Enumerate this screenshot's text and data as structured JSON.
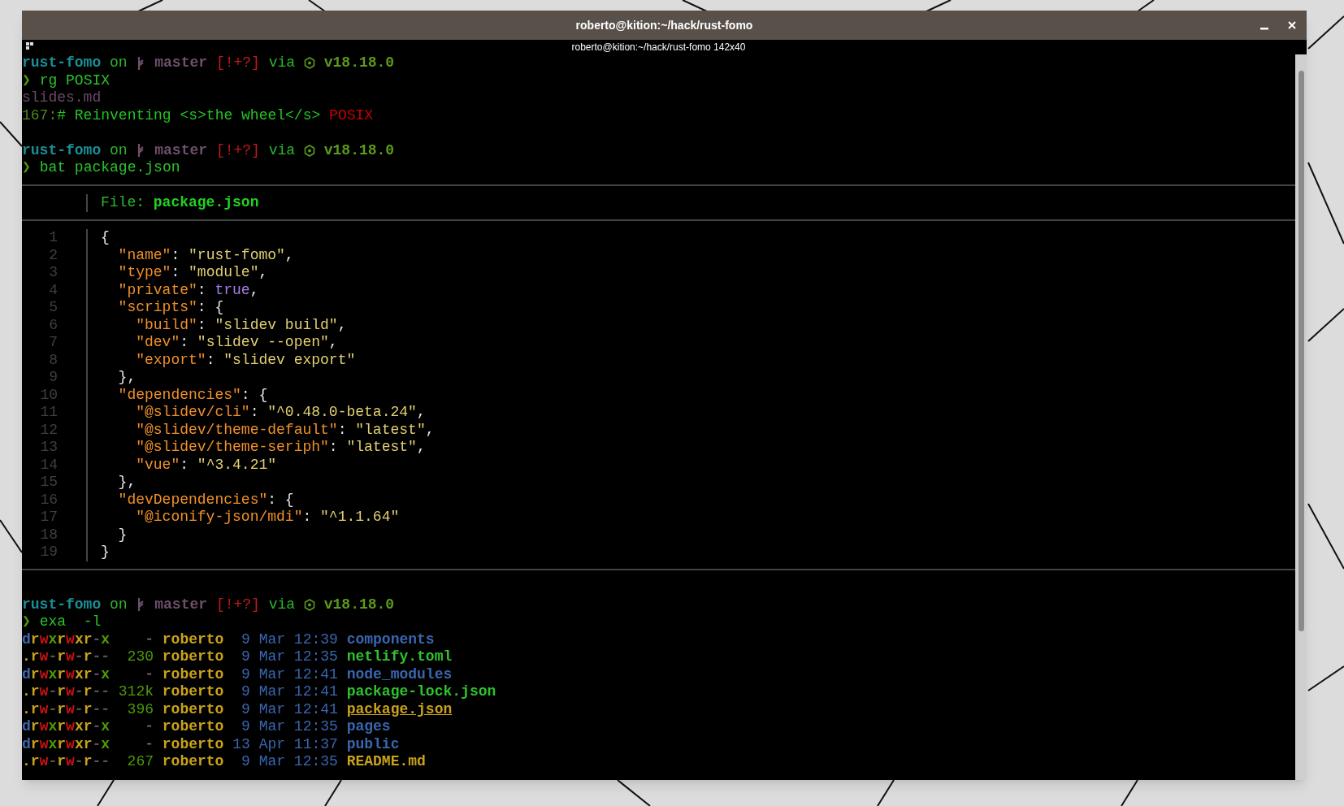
{
  "window": {
    "title": "roberto@kition:~/hack/rust-fomo",
    "subtitle": "roberto@kition:~/hack/rust-fomo 142x40"
  },
  "terminal": {
    "blocks": [
      {
        "kind": "prompt",
        "dir": "rust-fomo",
        "on": "on",
        "branch": "master",
        "status": "[!+?]",
        "via": "via",
        "version": "v18.18.0",
        "symbol": "❯",
        "command": "rg POSIX"
      },
      {
        "kind": "line",
        "segments": [
          {
            "text": "slides.md",
            "color": "#6a4a68"
          }
        ]
      },
      {
        "kind": "line",
        "segments": [
          {
            "text": "167:",
            "color": "#4f8a10"
          },
          {
            "text": "# Reinventing <s>the wheel</s> ",
            "color": "#22c422"
          },
          {
            "text": "POSIX",
            "color": "#c80000"
          }
        ]
      },
      {
        "kind": "blank"
      },
      {
        "kind": "prompt",
        "dir": "rust-fomo",
        "on": "on",
        "branch": "master",
        "status": "[!+?]",
        "via": "via",
        "version": "v18.18.0",
        "symbol": "❯",
        "command": "bat package.json"
      },
      {
        "kind": "bat",
        "label": "File: ",
        "file": "package.json",
        "lines": [
          {
            "number": "1",
            "segments": [
              {
                "text": "{",
                "color": "#e6e6e6"
              }
            ]
          },
          {
            "number": "2",
            "segments": [
              {
                "text": "  \"name\"",
                "color": "#f0902a"
              },
              {
                "text": ": ",
                "color": "#e6e6e6"
              },
              {
                "text": "\"rust-fomo\"",
                "color": "#e2cf72"
              },
              {
                "text": ",",
                "color": "#e6e6e6"
              }
            ]
          },
          {
            "number": "3",
            "segments": [
              {
                "text": "  \"type\"",
                "color": "#f0902a"
              },
              {
                "text": ": ",
                "color": "#e6e6e6"
              },
              {
                "text": "\"module\"",
                "color": "#e2cf72"
              },
              {
                "text": ",",
                "color": "#e6e6e6"
              }
            ]
          },
          {
            "number": "4",
            "segments": [
              {
                "text": "  \"private\"",
                "color": "#f0902a"
              },
              {
                "text": ": ",
                "color": "#e6e6e6"
              },
              {
                "text": "true",
                "color": "#a77ce8"
              },
              {
                "text": ",",
                "color": "#e6e6e6"
              }
            ]
          },
          {
            "number": "5",
            "segments": [
              {
                "text": "  \"scripts\"",
                "color": "#f0902a"
              },
              {
                "text": ": {",
                "color": "#e6e6e6"
              }
            ]
          },
          {
            "number": "6",
            "segments": [
              {
                "text": "    \"build\"",
                "color": "#f0902a"
              },
              {
                "text": ": ",
                "color": "#e6e6e6"
              },
              {
                "text": "\"slidev build\"",
                "color": "#e2cf72"
              },
              {
                "text": ",",
                "color": "#e6e6e6"
              }
            ]
          },
          {
            "number": "7",
            "segments": [
              {
                "text": "    \"dev\"",
                "color": "#f0902a"
              },
              {
                "text": ": ",
                "color": "#e6e6e6"
              },
              {
                "text": "\"slidev --open\"",
                "color": "#e2cf72"
              },
              {
                "text": ",",
                "color": "#e6e6e6"
              }
            ]
          },
          {
            "number": "8",
            "segments": [
              {
                "text": "    \"export\"",
                "color": "#f0902a"
              },
              {
                "text": ": ",
                "color": "#e6e6e6"
              },
              {
                "text": "\"slidev export\"",
                "color": "#e2cf72"
              }
            ]
          },
          {
            "number": "9",
            "segments": [
              {
                "text": "  },",
                "color": "#e6e6e6"
              }
            ]
          },
          {
            "number": "10",
            "segments": [
              {
                "text": "  \"dependencies\"",
                "color": "#f0902a"
              },
              {
                "text": ": {",
                "color": "#e6e6e6"
              }
            ]
          },
          {
            "number": "11",
            "segments": [
              {
                "text": "    \"@slidev/cli\"",
                "color": "#f0902a"
              },
              {
                "text": ": ",
                "color": "#e6e6e6"
              },
              {
                "text": "\"^0.48.0-beta.24\"",
                "color": "#e2cf72"
              },
              {
                "text": ",",
                "color": "#e6e6e6"
              }
            ]
          },
          {
            "number": "12",
            "segments": [
              {
                "text": "    \"@slidev/theme-default\"",
                "color": "#f0902a"
              },
              {
                "text": ": ",
                "color": "#e6e6e6"
              },
              {
                "text": "\"latest\"",
                "color": "#e2cf72"
              },
              {
                "text": ",",
                "color": "#e6e6e6"
              }
            ]
          },
          {
            "number": "13",
            "segments": [
              {
                "text": "    \"@slidev/theme-seriph\"",
                "color": "#f0902a"
              },
              {
                "text": ": ",
                "color": "#e6e6e6"
              },
              {
                "text": "\"latest\"",
                "color": "#e2cf72"
              },
              {
                "text": ",",
                "color": "#e6e6e6"
              }
            ]
          },
          {
            "number": "14",
            "segments": [
              {
                "text": "    \"vue\"",
                "color": "#f0902a"
              },
              {
                "text": ": ",
                "color": "#e6e6e6"
              },
              {
                "text": "\"^3.4.21\"",
                "color": "#e2cf72"
              }
            ]
          },
          {
            "number": "15",
            "segments": [
              {
                "text": "  },",
                "color": "#e6e6e6"
              }
            ]
          },
          {
            "number": "16",
            "segments": [
              {
                "text": "  \"devDependencies\"",
                "color": "#f0902a"
              },
              {
                "text": ": {",
                "color": "#e6e6e6"
              }
            ]
          },
          {
            "number": "17",
            "segments": [
              {
                "text": "    \"@iconify-json/mdi\"",
                "color": "#f0902a"
              },
              {
                "text": ": ",
                "color": "#e6e6e6"
              },
              {
                "text": "\"^1.1.64\"",
                "color": "#e2cf72"
              }
            ]
          },
          {
            "number": "18",
            "segments": [
              {
                "text": "  }",
                "color": "#e6e6e6"
              }
            ]
          },
          {
            "number": "19",
            "segments": [
              {
                "text": "}",
                "color": "#e6e6e6"
              }
            ]
          }
        ]
      },
      {
        "kind": "blank"
      },
      {
        "kind": "prompt",
        "dir": "rust-fomo",
        "on": "on",
        "branch": "master",
        "status": "[!+?]",
        "via": "via",
        "version": "v18.18.0",
        "symbol": "❯",
        "command": "exa  -l"
      },
      {
        "kind": "listing",
        "rows": [
          {
            "permissions": [
              {
                "text": "d",
                "color": "#3a66b0"
              },
              {
                "text": "r",
                "color": "#c9a21a"
              },
              {
                "text": "w",
                "color": "#cc1111"
              },
              {
                "text": "x",
                "color": "#4e9a06"
              },
              {
                "text": "r",
                "color": "#c9a21a"
              },
              {
                "text": "w",
                "color": "#cc1111"
              },
              {
                "text": "x",
                "color": "#c9a21a"
              },
              {
                "text": "r",
                "color": "#c9a21a"
              },
              {
                "text": "-",
                "color": "#555555"
              },
              {
                "text": "x",
                "color": "#4e9a06"
              }
            ],
            "size": {
              "text": "-",
              "color": "#888888"
            },
            "user": "roberto",
            "date": "9 Mar 12:39",
            "name": {
              "text": "components",
              "color": "#3a66b0",
              "underline": false
            }
          },
          {
            "permissions": [
              {
                "text": ".r",
                "color": "#c9a21a"
              },
              {
                "text": "w",
                "color": "#cc1111"
              },
              {
                "text": "-",
                "color": "#555555"
              },
              {
                "text": "r",
                "color": "#c9a21a"
              },
              {
                "text": "w",
                "color": "#cc1111"
              },
              {
                "text": "-",
                "color": "#555555"
              },
              {
                "text": "r",
                "color": "#c9a21a"
              },
              {
                "text": "--",
                "color": "#555555"
              }
            ],
            "size": {
              "text": "230",
              "color": "#4e9a06"
            },
            "user": "roberto",
            "date": "9 Mar 12:35",
            "name": {
              "text": "netlify.toml",
              "color": "#2ec22e",
              "underline": false
            }
          },
          {
            "permissions": [
              {
                "text": "d",
                "color": "#3a66b0"
              },
              {
                "text": "r",
                "color": "#c9a21a"
              },
              {
                "text": "w",
                "color": "#cc1111"
              },
              {
                "text": "x",
                "color": "#4e9a06"
              },
              {
                "text": "r",
                "color": "#c9a21a"
              },
              {
                "text": "w",
                "color": "#cc1111"
              },
              {
                "text": "x",
                "color": "#c9a21a"
              },
              {
                "text": "r",
                "color": "#c9a21a"
              },
              {
                "text": "-",
                "color": "#555555"
              },
              {
                "text": "x",
                "color": "#4e9a06"
              }
            ],
            "size": {
              "text": "-",
              "color": "#888888"
            },
            "user": "roberto",
            "date": "9 Mar 12:41",
            "name": {
              "text": "node_modules",
              "color": "#3a66b0",
              "underline": false
            }
          },
          {
            "permissions": [
              {
                "text": ".r",
                "color": "#c9a21a"
              },
              {
                "text": "w",
                "color": "#cc1111"
              },
              {
                "text": "-",
                "color": "#555555"
              },
              {
                "text": "r",
                "color": "#c9a21a"
              },
              {
                "text": "w",
                "color": "#cc1111"
              },
              {
                "text": "-",
                "color": "#555555"
              },
              {
                "text": "r",
                "color": "#c9a21a"
              },
              {
                "text": "--",
                "color": "#555555"
              }
            ],
            "size": {
              "text": "312k",
              "color": "#4e9a06"
            },
            "user": "roberto",
            "date": "9 Mar 12:41",
            "name": {
              "text": "package-lock.json",
              "color": "#2ec22e",
              "underline": false
            }
          },
          {
            "permissions": [
              {
                "text": ".r",
                "color": "#c9a21a"
              },
              {
                "text": "w",
                "color": "#cc1111"
              },
              {
                "text": "-",
                "color": "#555555"
              },
              {
                "text": "r",
                "color": "#c9a21a"
              },
              {
                "text": "w",
                "color": "#cc1111"
              },
              {
                "text": "-",
                "color": "#555555"
              },
              {
                "text": "r",
                "color": "#c9a21a"
              },
              {
                "text": "--",
                "color": "#555555"
              }
            ],
            "size": {
              "text": "396",
              "color": "#4e9a06"
            },
            "user": "roberto",
            "date": "9 Mar 12:41",
            "name": {
              "text": "package.json",
              "color": "#c9a21a",
              "underline": true
            }
          },
          {
            "permissions": [
              {
                "text": "d",
                "color": "#3a66b0"
              },
              {
                "text": "r",
                "color": "#c9a21a"
              },
              {
                "text": "w",
                "color": "#cc1111"
              },
              {
                "text": "x",
                "color": "#4e9a06"
              },
              {
                "text": "r",
                "color": "#c9a21a"
              },
              {
                "text": "w",
                "color": "#cc1111"
              },
              {
                "text": "x",
                "color": "#c9a21a"
              },
              {
                "text": "r",
                "color": "#c9a21a"
              },
              {
                "text": "-",
                "color": "#555555"
              },
              {
                "text": "x",
                "color": "#4e9a06"
              }
            ],
            "size": {
              "text": "-",
              "color": "#888888"
            },
            "user": "roberto",
            "date": "9 Mar 12:35",
            "name": {
              "text": "pages",
              "color": "#3a66b0",
              "underline": false
            }
          },
          {
            "permissions": [
              {
                "text": "d",
                "color": "#3a66b0"
              },
              {
                "text": "r",
                "color": "#c9a21a"
              },
              {
                "text": "w",
                "color": "#cc1111"
              },
              {
                "text": "x",
                "color": "#4e9a06"
              },
              {
                "text": "r",
                "color": "#c9a21a"
              },
              {
                "text": "w",
                "color": "#cc1111"
              },
              {
                "text": "x",
                "color": "#c9a21a"
              },
              {
                "text": "r",
                "color": "#c9a21a"
              },
              {
                "text": "-",
                "color": "#555555"
              },
              {
                "text": "x",
                "color": "#4e9a06"
              }
            ],
            "size": {
              "text": "-",
              "color": "#888888"
            },
            "user": "roberto",
            "date": "13 Apr 11:37",
            "name": {
              "text": "public",
              "color": "#3a66b0",
              "underline": false
            }
          },
          {
            "permissions": [
              {
                "text": ".r",
                "color": "#c9a21a"
              },
              {
                "text": "w",
                "color": "#cc1111"
              },
              {
                "text": "-",
                "color": "#555555"
              },
              {
                "text": "r",
                "color": "#c9a21a"
              },
              {
                "text": "w",
                "color": "#cc1111"
              },
              {
                "text": "-",
                "color": "#555555"
              },
              {
                "text": "r",
                "color": "#c9a21a"
              },
              {
                "text": "--",
                "color": "#555555"
              }
            ],
            "size": {
              "text": "267",
              "color": "#4e9a06"
            },
            "user": "roberto",
            "date": "9 Mar 12:35",
            "name": {
              "text": "README.md",
              "color": "#c9a21a",
              "underline": false
            }
          }
        ]
      }
    ]
  }
}
